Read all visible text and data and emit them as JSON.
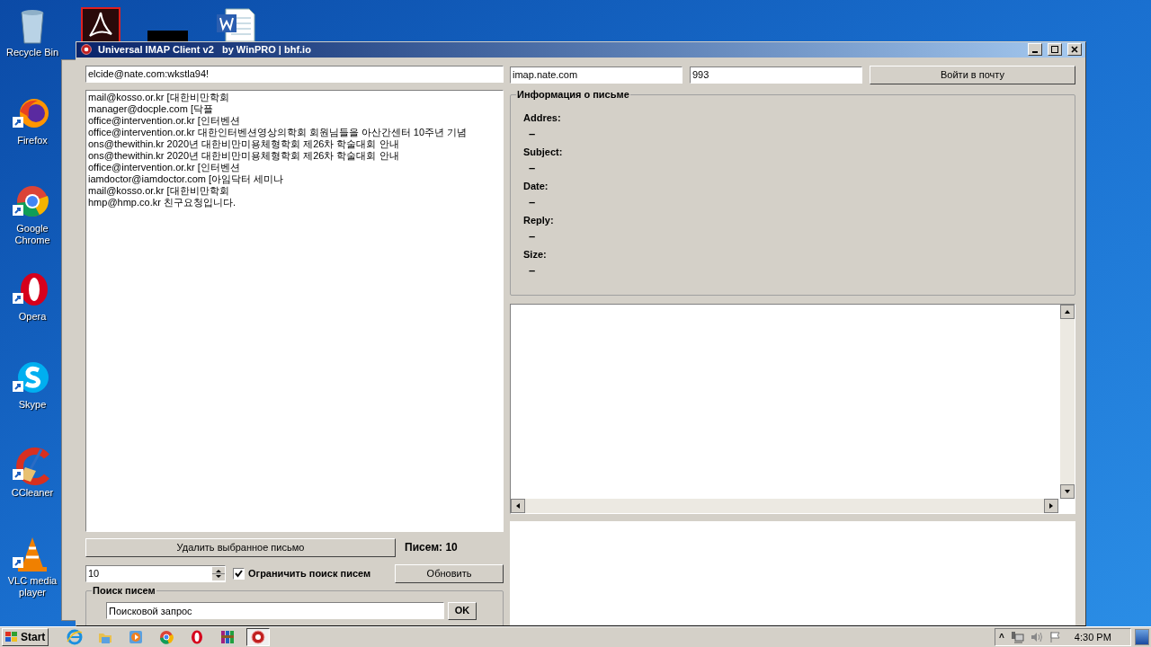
{
  "top_icons": [
    {
      "kind": "pdf"
    },
    {
      "kind": "redacted"
    },
    {
      "kind": "word"
    }
  ],
  "desktop_icons": [
    {
      "kind": "trash",
      "label": "Recycle Bin"
    },
    {
      "kind": "fox",
      "label": "Firefox"
    },
    {
      "kind": "chrome",
      "label": "Google Chrome"
    },
    {
      "kind": "opera",
      "label": "Opera"
    },
    {
      "kind": "skype",
      "label": "Skype"
    },
    {
      "kind": "ccleaner",
      "label": "CCleaner"
    },
    {
      "kind": "vlc",
      "label": "VLC media player"
    }
  ],
  "window": {
    "title": "Universal IMAP Client v2   by WinPRO | bhf.io",
    "login_field": "elcide@nate.com:wkstla94!",
    "host_field": "imap.nate.com",
    "port_field": "993",
    "login_button": "Войти в почту",
    "messages": [
      "mail@kosso.or.kr [대한비만학회",
      "manager@docple.com [닥플",
      "office@intervention.or.kr [인터벤션",
      "office@intervention.or.kr 대한인터벤션영상의학회 회원님들을 아산간센터 10주년 기념",
      "ons@thewithin.kr 2020년 대한비만미용체형학회 제26차 학술대회 안내",
      "ons@thewithin.kr 2020년 대한비만미용체형학회 제26차 학술대회 안내",
      "office@intervention.or.kr [인터벤션",
      "iamdoctor@iamdoctor.com [아임닥터 세미나",
      "mail@kosso.or.kr [대한비만학회",
      "hmp@hmp.co.kr 친구요청입니다."
    ],
    "delete_button": "Удалить выбранное письмо",
    "count_label": "Писем: 10",
    "limit_value": "10",
    "limit_checkbox": {
      "label": "Ограничить поиск писем",
      "checked": true
    },
    "refresh_button": "Обновить",
    "search_group": {
      "title": "Поиск писем",
      "query": "Поисковой запрос",
      "ok_button": "OK"
    },
    "info_group": {
      "title": "Информация о письме",
      "fields": [
        {
          "label": "Addres:",
          "value": "–"
        },
        {
          "label": "Subject:",
          "value": "–"
        },
        {
          "label": "Date:",
          "value": "–"
        },
        {
          "label": "Reply:",
          "value": "–"
        },
        {
          "label": "Size:",
          "value": "–"
        }
      ]
    }
  },
  "taskbar": {
    "start": "Start",
    "apps": [
      {
        "kind": "ie",
        "active": false
      },
      {
        "kind": "folder",
        "active": false
      },
      {
        "kind": "player",
        "active": false
      },
      {
        "kind": "chrome",
        "active": false
      },
      {
        "kind": "opera",
        "active": false
      },
      {
        "kind": "rar",
        "active": false
      },
      {
        "kind": "imap",
        "active": true
      }
    ],
    "tray_expand": "^",
    "clock": "4:30 PM"
  }
}
